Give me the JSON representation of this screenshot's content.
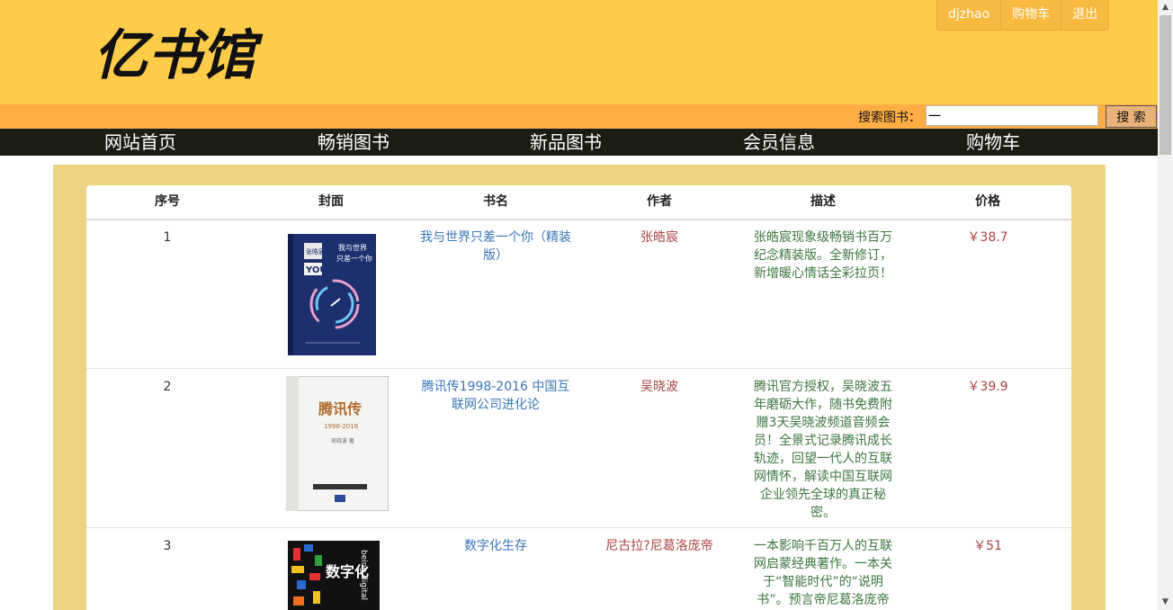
{
  "header": {
    "logo_text": "亿书馆",
    "user_menu": [
      {
        "label": "djzhao"
      },
      {
        "label": "购物车"
      },
      {
        "label": "退出"
      }
    ]
  },
  "search": {
    "label": "搜索图书：",
    "value": "一",
    "button": "搜 索"
  },
  "nav": {
    "items": [
      {
        "label": "网站首页"
      },
      {
        "label": "畅销图书"
      },
      {
        "label": "新品图书"
      },
      {
        "label": "会员信息"
      },
      {
        "label": "购物车"
      }
    ]
  },
  "table": {
    "headers": {
      "index": "序号",
      "cover": "封面",
      "title": "书名",
      "author": "作者",
      "desc": "描述",
      "price": "价格"
    },
    "rows": [
      {
        "index": "1",
        "title": "我与世界只差一个你（精装版）",
        "author": "张皓宸",
        "desc": "张皓宸现象级畅销书百万纪念精装版。全新修订，新增暖心情话全彩拉页！",
        "price": "￥38.7",
        "cover_text": [
          "张皓宸",
          "我与世界",
          "只差一个你",
          "YOU"
        ]
      },
      {
        "index": "2",
        "title": "腾讯传1998-2016 中国互联网公司进化论",
        "author": "吴晓波",
        "desc": "腾讯官方授权，吴晓波五年磨砺大作，随书免费附赠3天吴晓波频道音频会员！全景式记录腾讯成长轨迹，回望一代人的互联网情怀，解读中国互联网企业领先全球的真正秘密。",
        "price": "￥39.9",
        "cover_text": [
          "腾讯传",
          "1998-2016",
          "吴晓波 著"
        ]
      },
      {
        "index": "3",
        "title": "数字化生存",
        "author": "尼古拉?尼葛洛庞帝",
        "desc": "一本影响千百万人的互联网启蒙经典著作。一本关于“智能时代”的“说明书”。预言帝尼葛洛庞帝坦率回",
        "price": "￥51",
        "cover_text": [
          "数字化",
          "being digital"
        ]
      }
    ]
  },
  "colors": {
    "header_bg": "#ffcc4a",
    "searchbar_bg": "#ffad45",
    "nav_bg": "#1b1c14",
    "panel_bg": "#ecd483",
    "title_link": "#3b76b6",
    "author": "#a94442",
    "desc": "#3c763d"
  }
}
